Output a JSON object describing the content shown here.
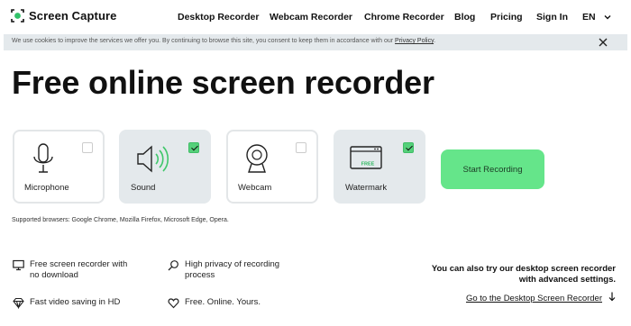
{
  "header": {
    "logo_text": "Screen Capture",
    "nav": [
      {
        "label": "Desktop Recorder"
      },
      {
        "label": "Webcam Recorder"
      },
      {
        "label": "Chrome Recorder"
      },
      {
        "label": "Blog"
      },
      {
        "label": "Pricing"
      },
      {
        "label": "Sign In"
      }
    ],
    "language": "EN"
  },
  "cookie_banner": {
    "text": "We use cookies to improve the services we offer you. By continuing to browse this site, you consent to keep them in accordance with our",
    "link": "Privacy Policy",
    "suffix": "."
  },
  "main": {
    "title": "Free online screen recorder",
    "options": [
      {
        "label": "Microphone",
        "checked": false,
        "icon": "microphone-icon"
      },
      {
        "label": "Sound",
        "checked": true,
        "icon": "speaker-icon"
      },
      {
        "label": "Webcam",
        "checked": false,
        "icon": "webcam-icon"
      },
      {
        "label": "Watermark",
        "checked": true,
        "icon": "watermark-icon",
        "badge": "FREE"
      }
    ],
    "start_button": "Start Recording",
    "supported": "Supported browsers: Google Chrome, Mozilla Firefox, Microsoft Edge, Opera."
  },
  "features": [
    {
      "text": "Free screen recorder with no download",
      "icon": "monitor-icon"
    },
    {
      "text": "High privacy of recording process",
      "icon": "search-icon"
    },
    {
      "text": "Fast video saving in HD",
      "icon": "diamond-icon"
    },
    {
      "text": "Free. Online. Yours.",
      "icon": "heart-icon"
    }
  ],
  "desktop_promo": {
    "line1": "You can also try our desktop screen recorder",
    "line2": "with advanced settings.",
    "link": "Go to the Desktop Screen Recorder"
  },
  "colors": {
    "accent_green": "#65e58a",
    "card_grey": "#e4e9ec",
    "check_green": "#55d07a"
  }
}
